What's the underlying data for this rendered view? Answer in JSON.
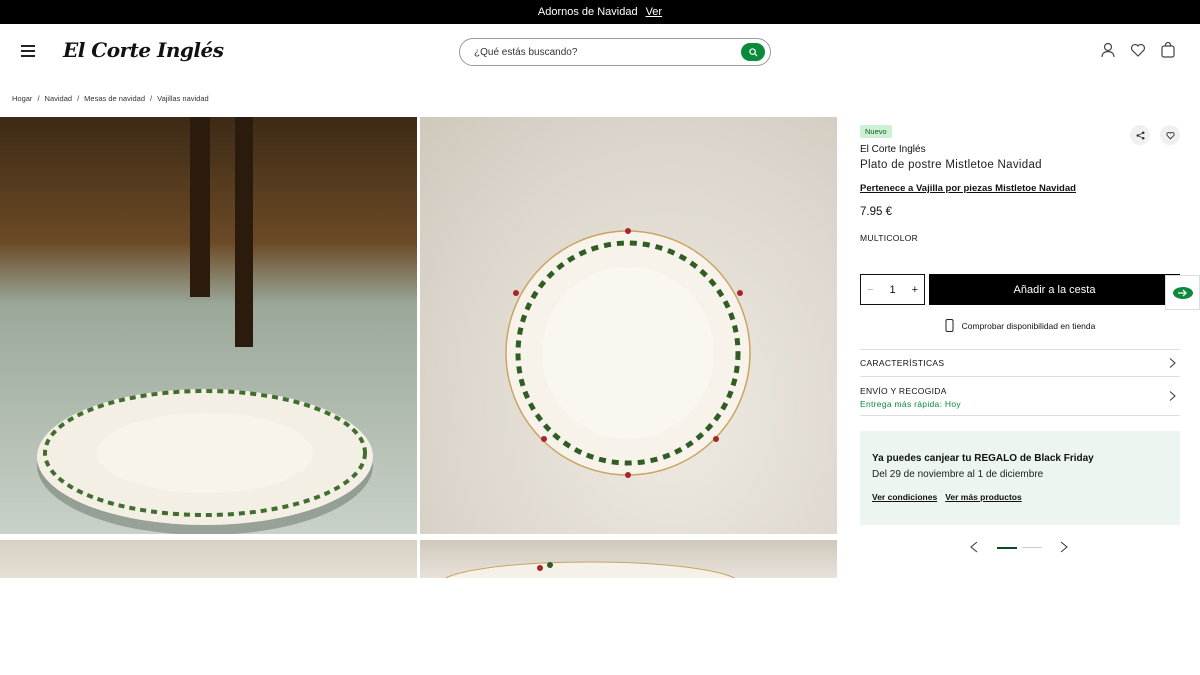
{
  "topbar": {
    "text": "Adornos de Navidad",
    "link": "Ver"
  },
  "header": {
    "logo": "El Corte Inglés",
    "search_placeholder": "¿Qué estás buscando?"
  },
  "breadcrumb": [
    "Hogar",
    "/",
    "Navidad",
    "/",
    "Mesas de navidad",
    "/",
    "Vajillas navidad"
  ],
  "product": {
    "badge": "Nuevo",
    "brand": "El Corte Inglés",
    "title": "Plato de postre Mistletoe Navidad",
    "belongs": "Pertenece a Vajilla por piezas Mistletoe Navidad",
    "price": "7.95 €",
    "color": "MULTICOLOR",
    "quantity": "1",
    "add_to_cart": "Añadir a la cesta",
    "availability": "Comprobar disponibilidad en tienda"
  },
  "accordion": {
    "features": "CARACTERÍSTICAS",
    "shipping": "ENVÍO Y RECOGIDA",
    "shipping_sub": "Entrega más rápida: Hoy"
  },
  "promo": {
    "headline": "Ya puedes canjear tu REGALO de Black Friday",
    "dates": "Del 29 de noviembre al 1 de diciembre",
    "link1": "Ver condiciones",
    "link2": "Ver más productos"
  },
  "colors": {
    "accent": "#0a8a3a",
    "badge_bg": "#cdf0d4",
    "promo_bg": "#ecf5ef"
  }
}
